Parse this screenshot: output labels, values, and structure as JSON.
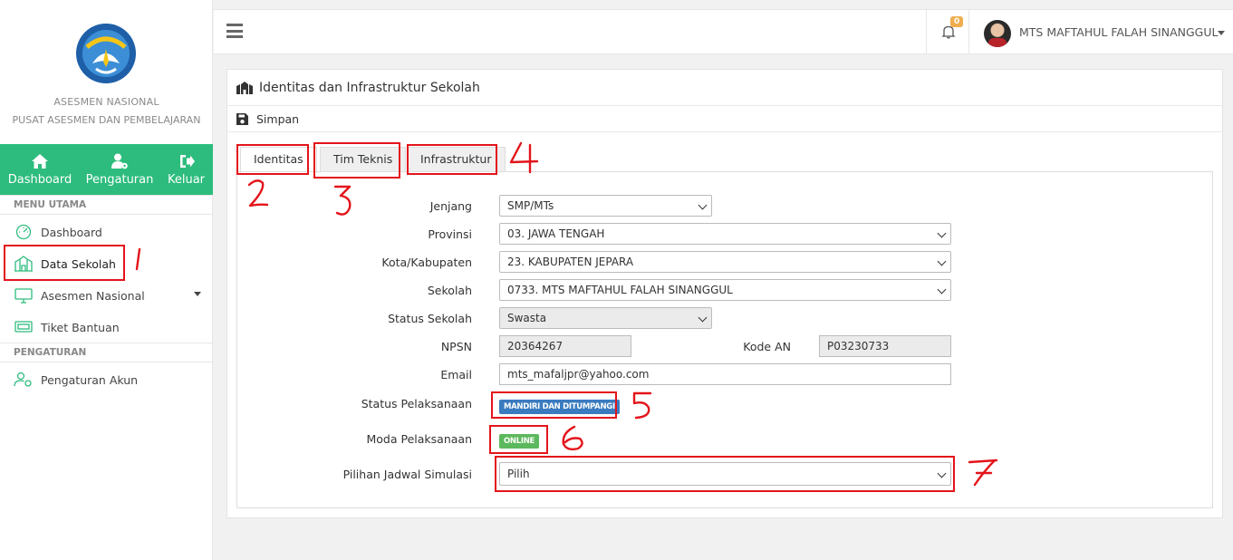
{
  "brand": {
    "line1": "ASESMEN NASIONAL",
    "line2": "PUSAT ASESMEN DAN PEMBELAJARAN",
    "logo_text": "TUT WURI HANDAYANI"
  },
  "quickbar": [
    {
      "label": "Dashboard",
      "icon": "home-icon"
    },
    {
      "label": "Pengaturan",
      "icon": "user-gear-icon"
    },
    {
      "label": "Keluar",
      "icon": "logout-icon"
    }
  ],
  "sidebar": {
    "menu_title": "MENU UTAMA",
    "items": [
      {
        "label": "Dashboard",
        "icon": "dashboard-icon"
      },
      {
        "label": "Data Sekolah",
        "icon": "school-icon"
      },
      {
        "label": "Asesmen Nasional",
        "icon": "monitor-icon"
      },
      {
        "label": "Tiket Bantuan",
        "icon": "ticket-icon"
      }
    ],
    "settings_title": "PENGATURAN",
    "settings_items": [
      {
        "label": "Pengaturan Akun",
        "icon": "user-settings-icon"
      }
    ]
  },
  "topbar": {
    "notif_count": "0",
    "user_name": "MTS MAFTAHUL FALAH SINANGGUL"
  },
  "panel": {
    "title": "Identitas dan Infrastruktur Sekolah",
    "save_label": "Simpan",
    "tabs": [
      "Identitas",
      "Tim Teknis",
      "Infrastruktur"
    ]
  },
  "form": {
    "jenjang": {
      "label": "Jenjang",
      "value": "SMP/MTs"
    },
    "provinsi": {
      "label": "Provinsi",
      "value": "03. JAWA TENGAH"
    },
    "kota": {
      "label": "Kota/Kabupaten",
      "value": "23. KABUPATEN JEPARA"
    },
    "sekolah": {
      "label": "Sekolah",
      "value": "0733. MTS MAFTAHUL FALAH SINANGGUL"
    },
    "status_sekolah": {
      "label": "Status Sekolah",
      "value": "Swasta"
    },
    "npsn": {
      "label": "NPSN",
      "value": "20364267"
    },
    "kode_an": {
      "label": "Kode AN",
      "value": "P03230733"
    },
    "email": {
      "label": "Email",
      "value": "mts_mafaljpr@yahoo.com"
    },
    "status_pelaksanaan": {
      "label": "Status Pelaksanaan",
      "value": "MANDIRI DAN DITUMPANGI"
    },
    "moda_pelaksanaan": {
      "label": "Moda Pelaksanaan",
      "value": "ONLINE"
    },
    "jadwal": {
      "label": "Pilihan Jadwal Simulasi",
      "value": "Pilih"
    }
  },
  "colors": {
    "accent": "#2dbc7d",
    "badge_blue": "#3a7bbf",
    "badge_green": "#5cb85c",
    "annotation_red": "#e3141b"
  }
}
